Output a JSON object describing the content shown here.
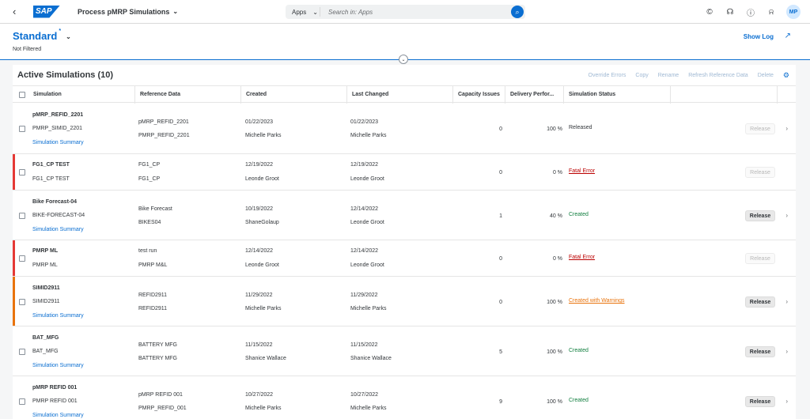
{
  "shell": {
    "logo_text": "SAP",
    "app_title": "Process pMRP Simulations",
    "search_scope": "Apps",
    "search_placeholder": "Search in: Apps",
    "avatar_initials": "MP"
  },
  "header": {
    "variant": "Standard",
    "variant_marker": "*",
    "filter_info": "Not Filtered",
    "show_log": "Show Log"
  },
  "table": {
    "title": "Active Simulations (10)",
    "actions": [
      "Override Errors",
      "Copy",
      "Rename",
      "Refresh Reference Data",
      "Delete"
    ],
    "columns": [
      "Simulation",
      "Reference Data",
      "Created",
      "Last Changed",
      "Capacity Issues",
      "Delivery Perfor...",
      "Simulation Status"
    ],
    "summary_link": "Simulation Summary",
    "release_label": "Release",
    "rows": [
      {
        "name": "pMRP_REFID_2201",
        "sub": "PMRP_SIMID_2201",
        "ref1": "pMRP_REFID_2201",
        "ref2": "PMRP_REFID_2201",
        "created_date": "01/22/2023",
        "created_by": "Michelle Parks",
        "changed_date": "01/22/2023",
        "changed_by": "Michelle Parks",
        "capacity": "0",
        "delivery": "100 %",
        "status": "Released",
        "status_type": "neutral",
        "summary": true,
        "release_enabled": false,
        "highlight": ""
      },
      {
        "name": "FG1_CP TEST",
        "sub": "FG1_CP TEST",
        "ref1": "FG1_CP",
        "ref2": "FG1_CP",
        "created_date": "12/19/2022",
        "created_by": "Leonde Groot",
        "changed_date": "12/19/2022",
        "changed_by": "Leonde Groot",
        "capacity": "0",
        "delivery": "0 %",
        "status": "Fatal Error",
        "status_type": "red",
        "summary": false,
        "release_enabled": false,
        "highlight": "#e53935"
      },
      {
        "name": "Bike Forecast-04",
        "sub": "BIKE-FORECAST-04",
        "ref1": "Bike Forecast",
        "ref2": "BIKES04",
        "created_date": "10/19/2022",
        "created_by": "ShaneGolaup",
        "changed_date": "12/14/2022",
        "changed_by": "Leonde Groot",
        "capacity": "1",
        "delivery": "40 %",
        "status": "Created",
        "status_type": "green",
        "summary": true,
        "release_enabled": true,
        "highlight": ""
      },
      {
        "name": "PMRP ML",
        "sub": "PMRP ML",
        "ref1": "test run",
        "ref2": "PMRP M&L",
        "created_date": "12/14/2022",
        "created_by": "Leonde Groot",
        "changed_date": "12/14/2022",
        "changed_by": "Leonde Groot",
        "capacity": "0",
        "delivery": "0 %",
        "status": "Fatal Error",
        "status_type": "red",
        "summary": false,
        "release_enabled": false,
        "highlight": "#e53935"
      },
      {
        "name": "SIMID2911",
        "sub": "SIMID2911",
        "ref1": "REFID2911",
        "ref2": "REFID2911",
        "created_date": "11/29/2022",
        "created_by": "Michelle Parks",
        "changed_date": "11/29/2022",
        "changed_by": "Michelle Parks",
        "capacity": "0",
        "delivery": "100 %",
        "status": "Created with Warnings",
        "status_type": "orange",
        "summary": true,
        "release_enabled": true,
        "highlight": "#e9730c"
      },
      {
        "name": "BAT_MFG",
        "sub": "BAT_MFG",
        "ref1": "BATTERY MFG",
        "ref2": "BATTERY MFG",
        "created_date": "11/15/2022",
        "created_by": "Shanice Wallace",
        "changed_date": "11/15/2022",
        "changed_by": "Shanice Wallace",
        "capacity": "5",
        "delivery": "100 %",
        "status": "Created",
        "status_type": "green",
        "summary": true,
        "release_enabled": true,
        "highlight": ""
      },
      {
        "name": "pMRP REFID 001",
        "sub": "PMRP REFID 001",
        "ref1": "pMRP REFID 001",
        "ref2": "PMRP_REFID_001",
        "created_date": "10/27/2022",
        "created_by": "Michelle Parks",
        "changed_date": "10/27/2022",
        "changed_by": "Michelle Parks",
        "capacity": "9",
        "delivery": "100 %",
        "status": "Created",
        "status_type": "green",
        "summary": true,
        "release_enabled": true,
        "highlight": ""
      }
    ]
  }
}
